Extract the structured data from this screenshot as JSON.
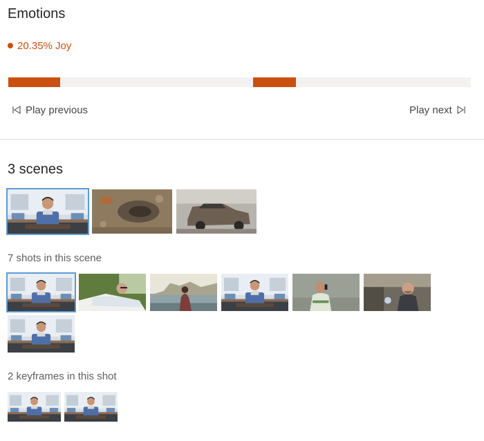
{
  "emotions": {
    "title": "Emotions",
    "current": "20.35% Joy",
    "dot_color": "#ca5010",
    "segments": [
      {
        "start_fraction": 0.0,
        "end_fraction": 0.112
      },
      {
        "start_fraction": 0.529,
        "end_fraction": 0.622
      }
    ],
    "play_previous": "Play previous",
    "play_next": "Play next",
    "play_previous_icon": "skip-back-icon",
    "play_next_icon": "skip-forward-icon"
  },
  "scenes": {
    "title": "3 scenes",
    "items": [
      {
        "name": "news-anchor",
        "selected": true
      },
      {
        "name": "rubble-ground",
        "selected": false
      },
      {
        "name": "burned-car",
        "selected": false
      }
    ]
  },
  "shots": {
    "label": "7 shots in this scene",
    "items": [
      {
        "name": "news-anchor",
        "selected": true
      },
      {
        "name": "man-reclining",
        "selected": false
      },
      {
        "name": "woman-seaside",
        "selected": false
      },
      {
        "name": "news-anchor",
        "selected": false
      },
      {
        "name": "man-on-phone",
        "selected": false
      },
      {
        "name": "man-talking",
        "selected": false
      },
      {
        "name": "news-anchor",
        "selected": false
      }
    ]
  },
  "keyframes": {
    "label": "2 keyframes in this shot",
    "items": [
      {
        "name": "news-anchor"
      },
      {
        "name": "news-anchor"
      }
    ]
  }
}
